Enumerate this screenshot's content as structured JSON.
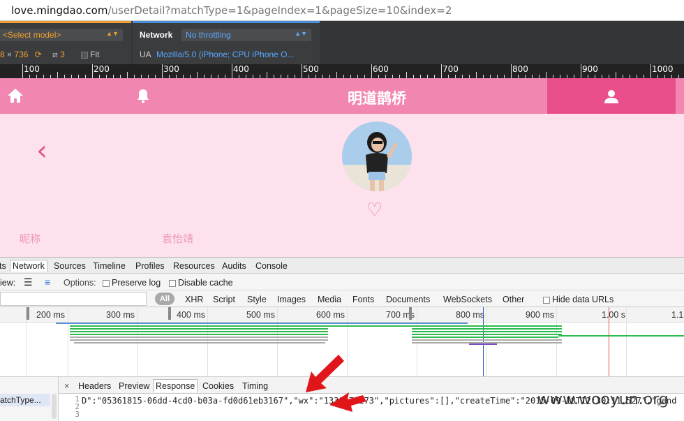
{
  "browser": {
    "url_host": "love.mingdao.com",
    "url_path": "/userDetail?matchType=1&pageIndex=1&pageSize=10&index=2"
  },
  "emulation": {
    "model_select": "<Select model>",
    "width_partial": "8",
    "times": "×",
    "height": "736",
    "scale": "3",
    "fit_label": "Fit",
    "network_label": "Network",
    "throttle": "No throttling",
    "ua_label": "UA",
    "ua_value": "Mozilla/5.0 (iPhone; CPU iPhone O..."
  },
  "ruler": {
    "labels": [
      "100",
      "200",
      "300",
      "400",
      "500",
      "600",
      "700",
      "800",
      "900",
      "1000"
    ]
  },
  "app": {
    "title": "明道鹊桥",
    "back_glyph": "‹",
    "nickname_label": "昵称",
    "nickname_value": "袁怡靖"
  },
  "devtools": {
    "panel_tabs": [
      "ts",
      "Network",
      "Sources",
      "Timeline",
      "Profiles",
      "Resources",
      "Audits",
      "Console"
    ],
    "active_panel": "Network",
    "view_label": "iew:",
    "options_label": "Options:",
    "preserve_log": "Preserve log",
    "disable_cache": "Disable cache",
    "filter_all": "All",
    "filter_types": [
      "XHR",
      "Script",
      "Style",
      "Images",
      "Media",
      "Fonts",
      "Documents",
      "WebSockets",
      "Other"
    ],
    "hide_data_urls": "Hide data URLs",
    "timeline_ticks": [
      "200 ms",
      "300 ms",
      "400 ms",
      "500 ms",
      "600 ms",
      "700 ms",
      "800 ms",
      "900 ms",
      "1.00 s",
      "1.1"
    ],
    "request_name": "atchType...",
    "detail_close": "×",
    "detail_tabs": [
      "Headers",
      "Preview",
      "Response",
      "Cookies",
      "Timing"
    ],
    "active_detail_tab": "Response",
    "line_numbers": [
      "1",
      "2",
      "3"
    ],
    "response_line": "D\":\"05361815-06dd-4cd0-b03a-fd0d61eb3167\",\"wx\":\"1331  71273\",\"pictures\":[],\"createTime\":\"2015-09-18T12:30:11.527\",\"gend"
  },
  "watermark": "www.wooyun.org",
  "colors": {
    "app_header": "#f187b1",
    "app_header_active": "#e84f8b",
    "profile_bg": "#fde2ee",
    "annotation_arrow": "#e0161b"
  }
}
